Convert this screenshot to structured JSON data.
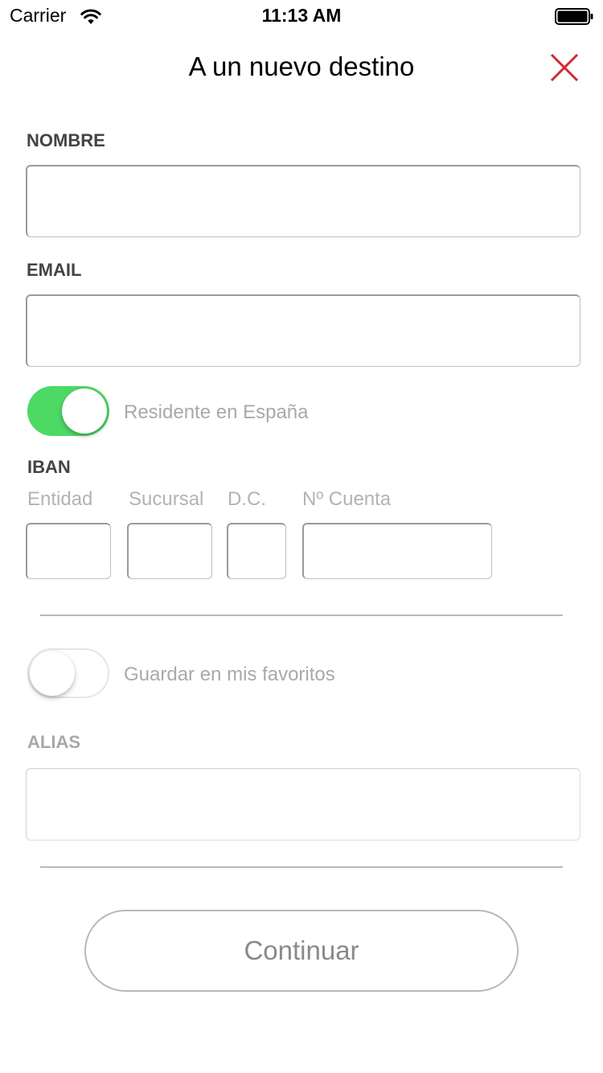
{
  "status_bar": {
    "carrier": "Carrier",
    "time": "11:13 AM",
    "wifi_icon": "wifi-icon",
    "battery_icon": "battery-full-icon"
  },
  "header": {
    "title": "A un nuevo destino",
    "close_icon": "close-icon",
    "close_color": "#d0282f"
  },
  "form": {
    "nombre": {
      "label": "NOMBRE",
      "value": "",
      "placeholder": ""
    },
    "email": {
      "label": "EMAIL",
      "value": "",
      "placeholder": ""
    },
    "resident": {
      "label": "Residente en España",
      "on": true,
      "on_color": "#4cd964"
    },
    "iban": {
      "label": "IBAN",
      "entidad": {
        "label": "Entidad",
        "value": ""
      },
      "sucursal": {
        "label": "Sucursal",
        "value": ""
      },
      "dc": {
        "label": "D.C.",
        "value": ""
      },
      "cuenta": {
        "label": "Nº Cuenta",
        "value": ""
      }
    },
    "favorites": {
      "label": "Guardar en mis favoritos",
      "on": false
    },
    "alias": {
      "label": "ALIAS",
      "value": "",
      "placeholder": ""
    }
  },
  "actions": {
    "continue_label": "Continuar"
  }
}
